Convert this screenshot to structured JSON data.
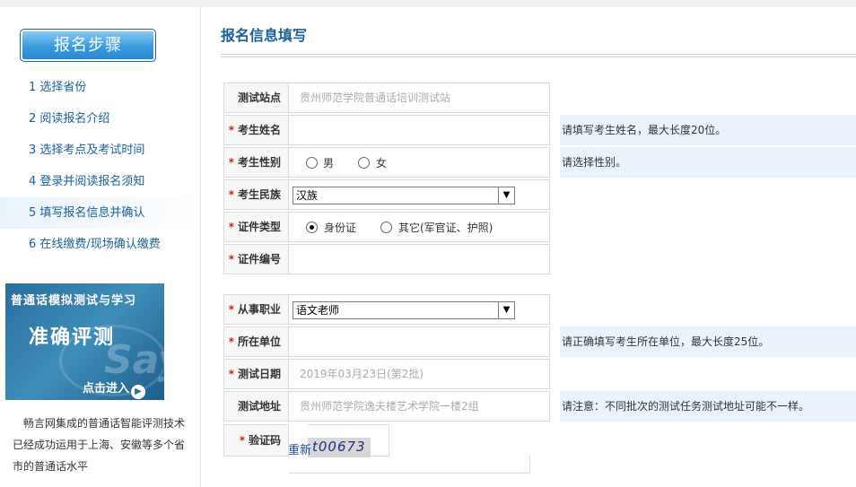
{
  "sidebar": {
    "header": "报名步骤",
    "steps": [
      "1 选择省份",
      "2 阅读报名介绍",
      "3 选择考点及考试时间",
      "4 登录并阅读报名须知",
      "5 填写报名信息并确认",
      "6 在线缴费/现场确认缴费"
    ],
    "banner": {
      "top_text": "普通话模拟测试与学习",
      "main_text": "准确评测",
      "watermark": "Say",
      "button": "点击进入",
      "arrow_icon": "▶"
    },
    "promo": "畅言网集成的普通话智能评测技术已经成功运用于上海、安徽等多个省市的普通话水平"
  },
  "form": {
    "title": "报名信息填写",
    "required_mark": "*",
    "fields": {
      "site": {
        "label": "测试站点",
        "value": "贵州师范学院普通话培训测试站"
      },
      "name": {
        "label": "考生姓名",
        "hint": "请填写考生姓名，最大长度20位。"
      },
      "gender": {
        "label": "考生性别",
        "options": [
          "男",
          "女"
        ],
        "hint": "请选择性别。"
      },
      "ethnicity": {
        "label": "考生民族",
        "selected": "汉族"
      },
      "id_type": {
        "label": "证件类型",
        "options": [
          "身份证",
          "其它(军官证、护照)"
        ],
        "selected": "身份证"
      },
      "id_number": {
        "label": "证件编号"
      },
      "occupation": {
        "label": "从事职业",
        "selected": "语文老师"
      },
      "workplace": {
        "label": "所在单位",
        "hint": "请正确填写考生所在单位，最大长度25位。"
      },
      "test_date": {
        "label": "测试日期",
        "value": "2019年03月23日(第2批)"
      },
      "test_address": {
        "label": "测试地址",
        "value": "贵州师范学院逸夫楼艺术学院一楼2组",
        "hint": "请注意：不同批次的测试任务测试地址可能不一样。"
      },
      "captcha": {
        "label": "验证码",
        "code": "t00673",
        "refresh_text": "重新"
      }
    },
    "dropdown_icon": "▼"
  }
}
